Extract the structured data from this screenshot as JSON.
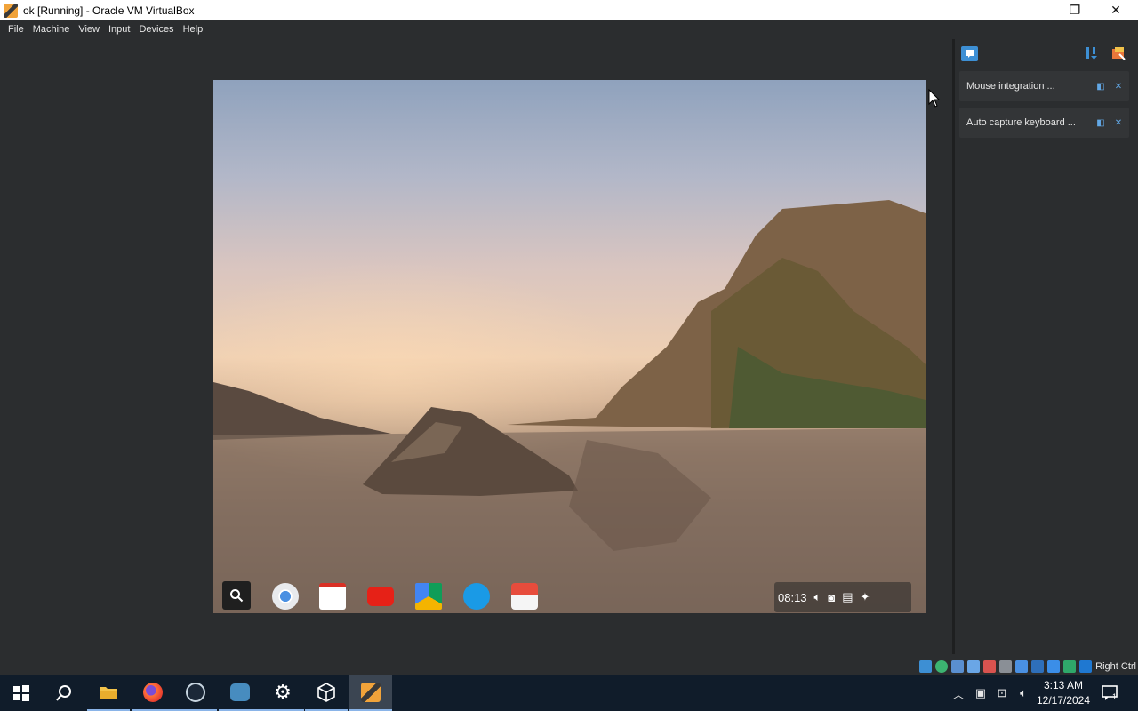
{
  "window": {
    "title": "ok [Running] - Oracle VM VirtualBox",
    "minimize_glyph": "—",
    "restore_glyph": "❐",
    "close_glyph": "✕"
  },
  "menubar": {
    "items": [
      "File",
      "Machine",
      "View",
      "Input",
      "Devices",
      "Help"
    ]
  },
  "guest": {
    "shelf_apps": [
      "chrome-icon",
      "gmail-icon",
      "youtube-icon",
      "drive-icon",
      "files-icon",
      "app-icon"
    ],
    "clock": "08:13"
  },
  "notifications": {
    "items": [
      {
        "text": "Mouse integration ..."
      },
      {
        "text": "Auto capture keyboard ..."
      }
    ]
  },
  "statusbar": {
    "host_key": "Right Ctrl"
  },
  "taskbar": {
    "apps": [
      "start-icon",
      "search-icon",
      "file-explorer-icon",
      "firefox-icon",
      "steam-icon",
      "game-icon",
      "settings-icon",
      "virtualbox-manager-icon",
      "virtualbox-vm-icon"
    ],
    "time": "3:13 AM",
    "date": "12/17/2024",
    "notification_count": "1"
  },
  "colors": {
    "chrome_bg": "#2b2d2f",
    "accent": "#3d8fd4",
    "taskbar": "#101c2a"
  }
}
